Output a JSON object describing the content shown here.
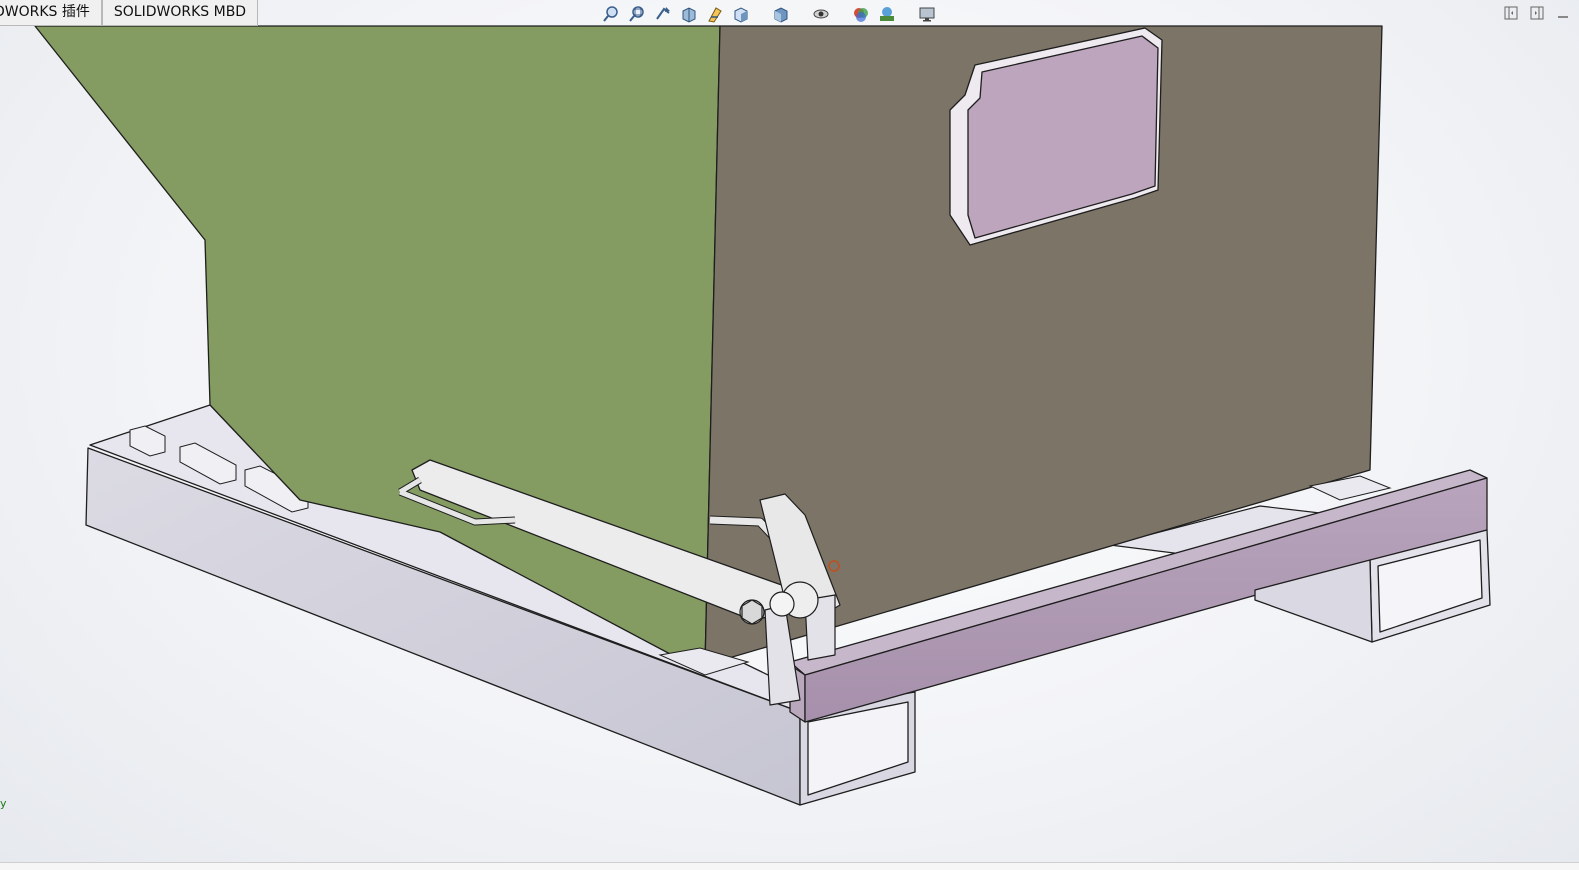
{
  "command_manager": {
    "tabs": [
      {
        "label": "DWORKS 插件"
      },
      {
        "label": "SOLIDWORKS MBD"
      }
    ]
  },
  "heads_up_toolbar": {
    "icons": [
      "zoom-to-fit-icon",
      "zoom-to-area-icon",
      "previous-view-icon",
      "section-view-icon",
      "dynamic-annotation-view-icon",
      "view-orientation-icon",
      "display-style-icon",
      "hide-show-items-icon",
      "edit-appearance-icon",
      "apply-scene-icon",
      "view-settings-icon"
    ]
  },
  "window_controls": {
    "icons": [
      "tile-left-icon",
      "tile-right-icon",
      "minimize-icon"
    ]
  },
  "model": {
    "colors": {
      "hopper_side": "#849b62",
      "hopper_front": "#7c7466",
      "frame": "#d2d1dc",
      "frame_rail": "#b09bb4",
      "window_panel": "#bca5bd",
      "pivot_disc": "#ebebeb",
      "edge": "#1e1e1e"
    }
  },
  "triad": {
    "label": "y"
  }
}
